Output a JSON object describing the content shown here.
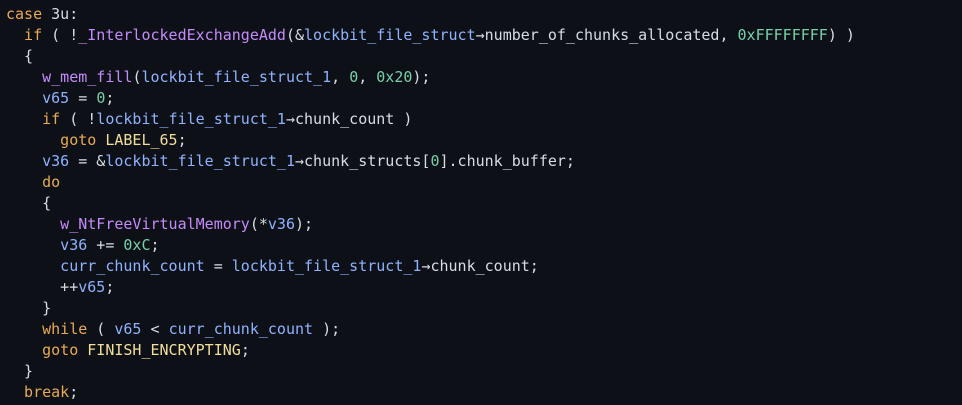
{
  "colors": {
    "background": "#0d1117",
    "keyword": "#e8a953",
    "function": "#c58af9",
    "variable": "#8fb2ff",
    "number": "#76d1a8",
    "label": "#f3de9a",
    "text": "#d6dde6"
  },
  "lines": [
    [
      [
        "kw",
        "case "
      ],
      [
        "plain",
        "3u:"
      ]
    ],
    [
      [
        "kw",
        "  if"
      ],
      [
        "plain",
        " ( !"
      ],
      [
        "fn",
        "_InterlockedExchangeAdd"
      ],
      [
        "plain",
        "(&"
      ],
      [
        "var",
        "lockbit_file_struct"
      ],
      [
        "plain",
        "→number_of_chunks_allocated, "
      ],
      [
        "num",
        "0xFFFFFFFF"
      ],
      [
        "plain",
        ") )"
      ]
    ],
    [
      [
        "plain",
        "  {"
      ]
    ],
    [
      [
        "fn",
        "    w_mem_fill"
      ],
      [
        "plain",
        "("
      ],
      [
        "var",
        "lockbit_file_struct_1"
      ],
      [
        "plain",
        ", "
      ],
      [
        "num",
        "0"
      ],
      [
        "plain",
        ", "
      ],
      [
        "num",
        "0x20"
      ],
      [
        "plain",
        ");"
      ]
    ],
    [
      [
        "var",
        "    v65"
      ],
      [
        "plain",
        " = "
      ],
      [
        "num",
        "0"
      ],
      [
        "plain",
        ";"
      ]
    ],
    [
      [
        "kw",
        "    if"
      ],
      [
        "plain",
        " ( !"
      ],
      [
        "var",
        "lockbit_file_struct_1"
      ],
      [
        "plain",
        "→chunk_count )"
      ]
    ],
    [
      [
        "kw",
        "      goto "
      ],
      [
        "lbl",
        "LABEL_65"
      ],
      [
        "plain",
        ";"
      ]
    ],
    [
      [
        "var",
        "    v36"
      ],
      [
        "plain",
        " = &"
      ],
      [
        "var",
        "lockbit_file_struct_1"
      ],
      [
        "plain",
        "→chunk_structs["
      ],
      [
        "num",
        "0"
      ],
      [
        "plain",
        "].chunk_buffer;"
      ]
    ],
    [
      [
        "kw",
        "    do"
      ]
    ],
    [
      [
        "plain",
        "    {"
      ]
    ],
    [
      [
        "fn",
        "      w_NtFreeVirtualMemory"
      ],
      [
        "plain",
        "(*"
      ],
      [
        "var",
        "v36"
      ],
      [
        "plain",
        ");"
      ]
    ],
    [
      [
        "var",
        "      v36"
      ],
      [
        "plain",
        " += "
      ],
      [
        "num",
        "0xC"
      ],
      [
        "plain",
        ";"
      ]
    ],
    [
      [
        "var",
        "      curr_chunk_count"
      ],
      [
        "plain",
        " = "
      ],
      [
        "var",
        "lockbit_file_struct_1"
      ],
      [
        "plain",
        "→chunk_count;"
      ]
    ],
    [
      [
        "plain",
        "      ++"
      ],
      [
        "var",
        "v65"
      ],
      [
        "plain",
        ";"
      ]
    ],
    [
      [
        "plain",
        "    }"
      ]
    ],
    [
      [
        "kw",
        "    while"
      ],
      [
        "plain",
        " ( "
      ],
      [
        "var",
        "v65"
      ],
      [
        "plain",
        " < "
      ],
      [
        "var",
        "curr_chunk_count"
      ],
      [
        "plain",
        " );"
      ]
    ],
    [
      [
        "kw",
        "    goto "
      ],
      [
        "lbl",
        "FINISH_ENCRYPTING"
      ],
      [
        "plain",
        ";"
      ]
    ],
    [
      [
        "plain",
        "  }"
      ]
    ],
    [
      [
        "kw",
        "  break"
      ],
      [
        "plain",
        ";"
      ]
    ]
  ]
}
